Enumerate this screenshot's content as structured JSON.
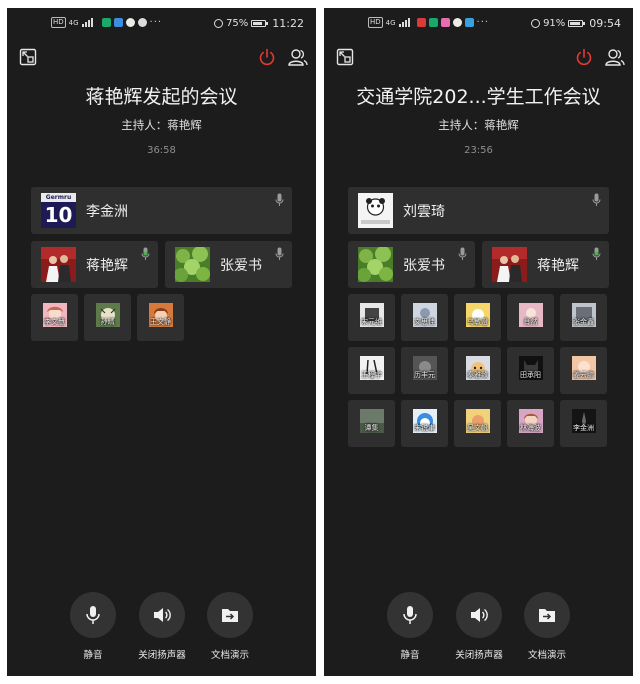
{
  "left": {
    "status": {
      "battery": "75%",
      "time": "11:22",
      "network": "4G"
    },
    "title": "蒋艳辉发起的会议",
    "host_label": "主持人：",
    "host_name": "蒋艳辉",
    "timer": "36:58",
    "speaker_main": {
      "name": "李金洲",
      "avatar_text": "Germru",
      "avatar_number": "10"
    },
    "speakers": [
      {
        "name": "蒋艳辉"
      },
      {
        "name": "张爱书"
      }
    ],
    "tiles": [
      {
        "name": "李文慧"
      },
      {
        "name": "孙晴"
      },
      {
        "name": "王文静"
      }
    ]
  },
  "right": {
    "status": {
      "battery": "91%",
      "time": "09:54",
      "network": "4G"
    },
    "title": "交通学院202...学生工作会议",
    "host_label": "主持人：",
    "host_name": "蒋艳辉",
    "timer": "23:56",
    "speaker_main": {
      "name": "刘雲琦"
    },
    "speakers": [
      {
        "name": "张爱书"
      },
      {
        "name": "蒋艳辉"
      }
    ],
    "tiles": [
      {
        "name": "宋元维"
      },
      {
        "name": "文思佳"
      },
      {
        "name": "乌敏澄"
      },
      {
        "name": "肖然"
      },
      {
        "name": "张金鑫"
      },
      {
        "name": "王程宇"
      },
      {
        "name": "历丰元"
      },
      {
        "name": "秦雅致"
      },
      {
        "name": "田承阳"
      },
      {
        "name": "姜云鹏"
      },
      {
        "name": "谭集"
      },
      {
        "name": "宋锐聿"
      },
      {
        "name": "吴文帆"
      },
      {
        "name": "林海波"
      },
      {
        "name": "李金洲"
      }
    ]
  },
  "controls": [
    {
      "label": "静音",
      "icon": "mic-icon"
    },
    {
      "label": "关闭扬声器",
      "icon": "speaker-icon"
    },
    {
      "label": "文档演示",
      "icon": "share-doc-icon"
    }
  ],
  "colors": {
    "background": "#1c1c1c",
    "card": "#2f2f2f",
    "power_red": "#e53935",
    "mic_active_green": "#4caf50",
    "control_circle": "#333333"
  }
}
